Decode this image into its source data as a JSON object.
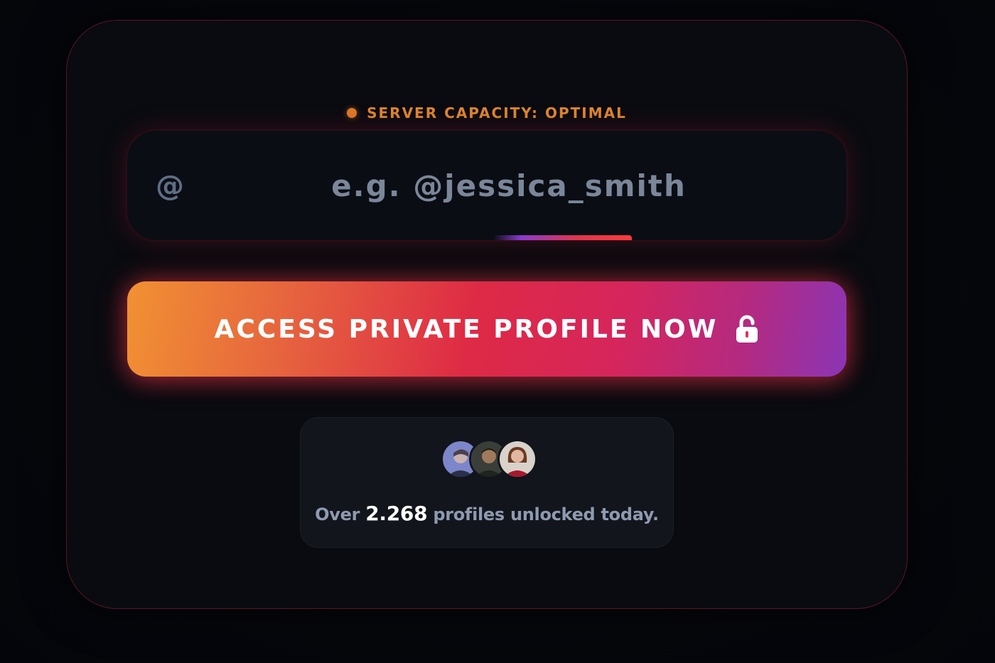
{
  "status": {
    "label": "SERVER CAPACITY: OPTIMAL",
    "dot_color": "#e07a28",
    "text_color": "#e0872e"
  },
  "search": {
    "prefix_icon": "at-sign-icon",
    "prefix_glyph": "@",
    "placeholder": "e.g. @jessica_smith",
    "value": ""
  },
  "cta": {
    "label": "ACCESS PRIVATE PROFILE NOW",
    "icon": "unlock-icon",
    "gradient_colors": [
      "#f19133",
      "#de2a45",
      "#8b35b5"
    ]
  },
  "social_proof": {
    "avatars": [
      "avatar-1",
      "avatar-2",
      "avatar-3"
    ],
    "prefix": "Over",
    "count": "2.268",
    "suffix": "profiles unlocked today."
  },
  "colors": {
    "background": "#04060b",
    "card": "#090b10",
    "card_border": "#5a1524"
  }
}
